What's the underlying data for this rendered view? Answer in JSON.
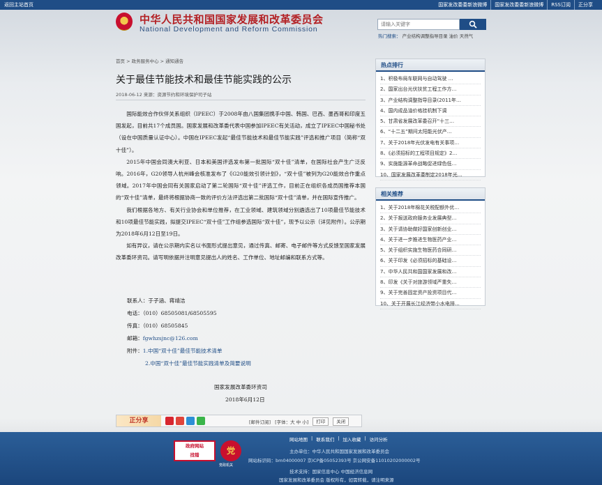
{
  "topbar": {
    "home": "返回主站首页",
    "links": [
      "国家发改委委新浪微博",
      "国家发改委委新浪微博",
      "RSS订阅",
      "正分享"
    ]
  },
  "header": {
    "title_cn": "中华人民共和国国家发展和改革委员会",
    "title_en": "National Development and Reform Commission",
    "search_placeholder": "请输入关键字",
    "hot_label": "热门搜索：",
    "hot_terms": "产业结构调整指导目录 油价 天然气"
  },
  "breadcrumb": "首页 > 政务服务中心 > 通知通告",
  "article": {
    "title": "关于最佳节能技术和最佳节能实践的公示",
    "date": "2018-06-12",
    "source": "来源：资源节约和环境保护司子站",
    "paragraphs": [
      "国际能效合作伙伴关系组织（IPEEC）于2008年由八国集团携手中国、韩国、巴西、墨西哥和印度五国发起，目前共17个成员国。国家发展和改革委代表中国参加IPEEC有关活动，成立了IPEEC中国秘书处（设在中国质量认证中心）。中国在IPEEC发起“最佳节能技术和最佳节能实践”评选和推广项目（简称“双十佳”）。",
      "2015年中国会同澳大利亚、日本和美国评选发布第一批国际“双十佳”清单，在国际社会产生广泛反响。2016年，G20领导人杭州峰会核准发布了《G20能效引领计划》，“双十佳”被列为G20能效合作重点领域。2017年中国会同有关国家启动了第二轮国际“双十佳”评选工作，目前正在组织各成员国推荐本国的“双十佳”清单，最终将根据协商一致的评价方法评选出第二批国际“双十佳”清单，并在国际宣传推广。",
      "我们根据各地方、有关行业协会和单位推荐，在工业领域、建筑领域分别遴选出了10项最佳节能技术和10项最佳节能实践，拟提交IPEEC“双十佳”工作组参选国际“双十佳”，现予以公示（详见附件）。公示期为2018年6月12日至19日。",
      "如有异议，请在公示期内实名以书面形式提出意见，通过传真、邮寄、电子邮件等方式反馈至国家发展改革委环资司。请写明依据并注明意见提出人的姓名、工作单位、地址邮编和联系方式等。"
    ],
    "contact_person": "联系人：于子涵、蒋靖洁",
    "phone": "电话：（010）68505081/68505595",
    "fax": "传真：（010）68505845",
    "email_label": "邮箱：",
    "email": "fgwhzsjnc@126.com",
    "attach_label": "附件：",
    "attach1": "1.中国“双十佳”最佳节能技术清单",
    "attach2": "2.中国“双十佳”最佳节能实践清单及简要说明",
    "sign_org": "国家发展改革委环资司",
    "sign_date": "2018年6月12日"
  },
  "share": {
    "label": "正分享",
    "tools": [
      "[邮件订阅]",
      "[字体：大 中 小]",
      "打印",
      "关闭"
    ]
  },
  "sidebar": {
    "hot": {
      "title": "热点排行",
      "items": [
        "1、积极布局车联网与自动驾驶 …",
        "2、国家出台光伏扶贫工程工作方…",
        "3、产业结构调整指导目录(2011年…",
        "4、国内成品油价格挂机制下调",
        "5、甘肃省发展改革委召开“十三…",
        "6、“十二五”期间太阳能光伏产…",
        "7、关于2018年光伏发电有关事项…",
        "8、《必须招标的工程项目规定》2…",
        "9、实施能源革命战略促进绿色低…",
        "10、国家发展改革委制定2018年光…"
      ]
    },
    "related": {
      "title": "相关推荐",
      "items": [
        "1、关于2018年棉花关税配额外优…",
        "2、关于报送政府服务业发展典型…",
        "3、关于请协助做好国家创新创业…",
        "4、关于进一步推进生物医药产业…",
        "5、关于组织实施生物医药合同研…",
        "6、关于印发《必须招标的基础设…",
        "7、中华人民共和国国家发展和改…",
        "8、印发《关于对旅游领域严重失…",
        "9、关于完善固定资产投资项目代…",
        "10、关于开展长江经济带小水电排…"
      ]
    }
  },
  "footer": {
    "links": [
      "网站地图",
      "|",
      "联系我们",
      "|",
      "加入收藏",
      "|",
      "访问分析"
    ],
    "sponsor": "主办单位：中华人民共和国国家发展和改革委员会",
    "icp": "网站标识码：bm04000007 京ICP备05052393号  京公网安备11010202000002号",
    "tech": "技术支持：国家信息中心  中国经济信息网",
    "copyright": "国家发展和改革委员会  版权所有，如需转载，请注明来源",
    "badge1_line1": "政府网站",
    "badge1_line2": "找错",
    "badge2_text": "党",
    "badge2_caption": "党政机关"
  }
}
